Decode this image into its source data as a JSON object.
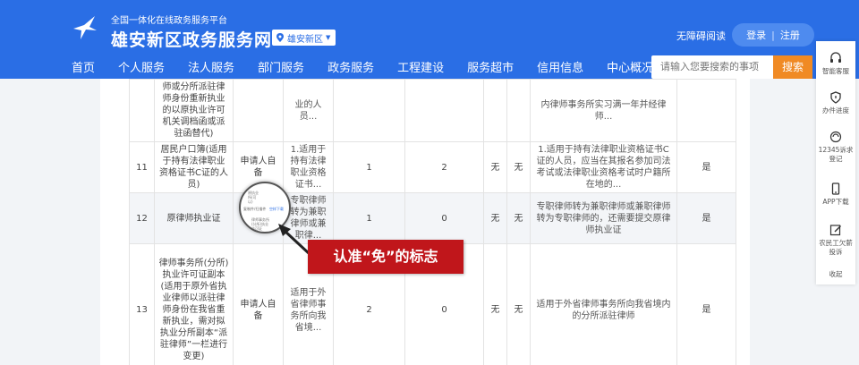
{
  "header": {
    "subtitle": "全国一体化在线政务服务平台",
    "title": "雄安新区政务服务网",
    "region": "雄安新区",
    "accessibility": "无障碍阅读",
    "login": "登录",
    "separator": "|",
    "register": "注册"
  },
  "nav": [
    "首页",
    "个人服务",
    "法人服务",
    "部门服务",
    "政务服务",
    "工程建设",
    "服务超市",
    "信用信息",
    "中心概况"
  ],
  "search": {
    "placeholder": "请输入您要搜索的事项",
    "button": "搜索"
  },
  "table": {
    "rows": [
      {
        "no": "",
        "name": "师或分所派驻律师身份重新执业的以原执业许可机关调档函或派驻函替代)",
        "source": "",
        "desc": "业的人员...",
        "c1": "",
        "c2": "",
        "c3": "",
        "c4": "",
        "cond": "内律师事务所实习满一年并经律师...",
        "yes": ""
      },
      {
        "no": "11",
        "name": "居民户口簿(适用于持有法律职业资格证书C证的人员)",
        "source": "申请人自备",
        "desc": "1.适用于持有法律职业资格证书...",
        "c1": "1",
        "c2": "2",
        "c3": "无",
        "c4": "无",
        "cond": "1.适用于持有法律职业资格证书C证的人员，应当在其报名参加司法考试或法律职业资格考试时户籍所在地的...",
        "yes": "是"
      },
      {
        "no": "12",
        "name": "原律师执业证",
        "source": "",
        "desc": "专职律师转为兼职律师或兼职律...",
        "c1": "1",
        "c2": "0",
        "c3": "无",
        "c4": "无",
        "cond": "专职律师转为兼职律师或兼职律师转为专职律师的，还需要提交原律师执业证",
        "yes": "是"
      },
      {
        "no": "13",
        "name": "律师事务所(分所)执业许可证副本(适用于原外省执业律师以派驻律师身份在我省重新执业，需对拟执业分所副本“派驻律师”一栏进行变更)",
        "source": "申请人自备",
        "desc": "适用于外省律师事务所向我省境...",
        "c1": "2",
        "c2": "0",
        "c3": "无",
        "c4": "无",
        "cond": "适用于外省律师事务所向我省境内的分所派驻律师",
        "yes": "是"
      }
    ]
  },
  "magnifier": {
    "top_text": "原执业所(可以)",
    "left_text": "复制件/扫描件",
    "right_text": "空样下载",
    "bottom_text": "律师事务所(分所)执业许可证"
  },
  "callout": "认准“免”的标志",
  "sidebar": {
    "items": [
      {
        "label": "智能客服",
        "icon": "headset-icon"
      },
      {
        "label": "办件进度",
        "icon": "shield-icon"
      },
      {
        "label": "12345诉求登记",
        "icon": "phone-icon"
      },
      {
        "label": "APP下载",
        "icon": "mobile-icon"
      },
      {
        "label": "农民工欠薪投诉",
        "icon": "edit-icon"
      },
      {
        "label": "收起",
        "icon": ""
      }
    ]
  },
  "colors": {
    "primary": "#2a6ee5",
    "search_button": "#f08a24",
    "callout": "#c0161b"
  }
}
